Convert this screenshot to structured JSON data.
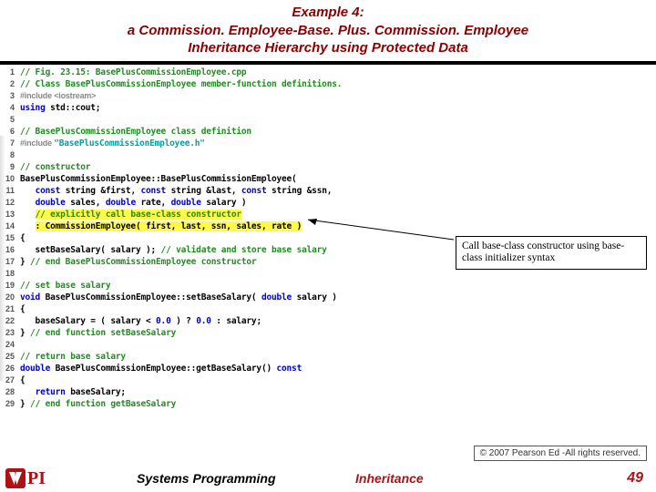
{
  "header": {
    "line1": "Example 4:",
    "line2": "a Commission. Employee-Base. Plus. Commission. Employee",
    "line3": "Inheritance Hierarchy using Protected Data"
  },
  "code": [
    {
      "n": "1",
      "segs": [
        {
          "t": "// Fig. 23.15: BasePlusCommissionEmployee.cpp",
          "c": "cmt"
        }
      ]
    },
    {
      "n": "2",
      "segs": [
        {
          "t": "// Class BasePlusCommissionEmployee member-function definitions.",
          "c": "cmt"
        }
      ]
    },
    {
      "n": "3",
      "segs": [
        {
          "t": "#include <iostream>",
          "c": "inc"
        }
      ]
    },
    {
      "n": "4",
      "segs": [
        {
          "t": "using ",
          "c": "kw"
        },
        {
          "t": "std::cout;",
          "c": ""
        }
      ]
    },
    {
      "n": "5",
      "segs": [
        {
          "t": "",
          "c": ""
        }
      ]
    },
    {
      "n": "6",
      "segs": [
        {
          "t": "// BasePlusCommissionEmployee class definition",
          "c": "cmt"
        }
      ]
    },
    {
      "n": "7",
      "segs": [
        {
          "t": "#include ",
          "c": "inc"
        },
        {
          "t": "\"BasePlusCommissionEmployee.h\"",
          "c": "str"
        }
      ]
    },
    {
      "n": "8",
      "segs": [
        {
          "t": "",
          "c": ""
        }
      ]
    },
    {
      "n": "9",
      "segs": [
        {
          "t": "// constructor",
          "c": "cmt"
        }
      ]
    },
    {
      "n": "10",
      "segs": [
        {
          "t": "BasePlusCommissionEmployee::BasePlusCommissionEmployee( ",
          "c": ""
        }
      ]
    },
    {
      "n": "11",
      "segs": [
        {
          "t": "   ",
          "c": ""
        },
        {
          "t": "const ",
          "c": "kw"
        },
        {
          "t": "string &first, ",
          "c": ""
        },
        {
          "t": "const ",
          "c": "kw"
        },
        {
          "t": "string &last, ",
          "c": ""
        },
        {
          "t": "const ",
          "c": "kw"
        },
        {
          "t": "string &ssn, ",
          "c": ""
        }
      ]
    },
    {
      "n": "12",
      "segs": [
        {
          "t": "   ",
          "c": ""
        },
        {
          "t": "double ",
          "c": "kw"
        },
        {
          "t": "sales, ",
          "c": ""
        },
        {
          "t": "double ",
          "c": "kw"
        },
        {
          "t": "rate, ",
          "c": ""
        },
        {
          "t": "double ",
          "c": "kw"
        },
        {
          "t": "salary )",
          "c": ""
        }
      ]
    },
    {
      "n": "13",
      "segs": [
        {
          "t": "   ",
          "c": ""
        },
        {
          "t": "// explicitly call base-class constructor",
          "c": "cmt hl"
        }
      ]
    },
    {
      "n": "14",
      "segs": [
        {
          "t": "   ",
          "c": ""
        },
        {
          "t": ": CommissionEmployee( first, last, ssn, sales, rate )",
          "c": "hl"
        }
      ]
    },
    {
      "n": "15",
      "segs": [
        {
          "t": "{  ",
          "c": ""
        }
      ]
    },
    {
      "n": "16",
      "segs": [
        {
          "t": "   setBaseSalary( salary ); ",
          "c": ""
        },
        {
          "t": "// validate and store base salary",
          "c": "cmt"
        }
      ]
    },
    {
      "n": "17",
      "segs": [
        {
          "t": "} ",
          "c": ""
        },
        {
          "t": "// end BasePlusCommissionEmployee constructor",
          "c": "cmt"
        }
      ]
    },
    {
      "n": "18",
      "segs": [
        {
          "t": "",
          "c": ""
        }
      ]
    },
    {
      "n": "19",
      "segs": [
        {
          "t": "// set base salary",
          "c": "cmt"
        }
      ]
    },
    {
      "n": "20",
      "segs": [
        {
          "t": "void ",
          "c": "kw"
        },
        {
          "t": "BasePlusCommissionEmployee::setBaseSalary( ",
          "c": ""
        },
        {
          "t": "double ",
          "c": "kw"
        },
        {
          "t": "salary )",
          "c": ""
        }
      ]
    },
    {
      "n": "21",
      "segs": [
        {
          "t": "{",
          "c": ""
        }
      ]
    },
    {
      "n": "22",
      "segs": [
        {
          "t": "   baseSalary = ( salary < ",
          "c": ""
        },
        {
          "t": "0.0",
          "c": "kw"
        },
        {
          "t": " ) ? ",
          "c": ""
        },
        {
          "t": "0.0",
          "c": "kw"
        },
        {
          "t": " : salary;",
          "c": ""
        }
      ]
    },
    {
      "n": "23",
      "segs": [
        {
          "t": "} ",
          "c": ""
        },
        {
          "t": "// end function setBaseSalary",
          "c": "cmt"
        }
      ]
    },
    {
      "n": "24",
      "segs": [
        {
          "t": "",
          "c": ""
        }
      ]
    },
    {
      "n": "25",
      "segs": [
        {
          "t": "// return base salary",
          "c": "cmt"
        }
      ]
    },
    {
      "n": "26",
      "segs": [
        {
          "t": "double ",
          "c": "kw"
        },
        {
          "t": "BasePlusCommissionEmployee::getBaseSalary() ",
          "c": ""
        },
        {
          "t": "const",
          "c": "kw"
        }
      ]
    },
    {
      "n": "27",
      "segs": [
        {
          "t": "{",
          "c": ""
        }
      ]
    },
    {
      "n": "28",
      "segs": [
        {
          "t": "   ",
          "c": ""
        },
        {
          "t": "return ",
          "c": "kw"
        },
        {
          "t": "baseSalary;",
          "c": ""
        }
      ]
    },
    {
      "n": "29",
      "segs": [
        {
          "t": "} ",
          "c": ""
        },
        {
          "t": "// end function getBaseSalary",
          "c": "cmt"
        }
      ]
    }
  ],
  "callout": {
    "text": "Call base-class constructor using base-class initializer syntax"
  },
  "copyright": "© 2007 Pearson Ed -All rights reserved.",
  "footer": {
    "logo_text": "PI",
    "left": "Systems Programming",
    "mid": "Inheritance",
    "page": "49"
  }
}
